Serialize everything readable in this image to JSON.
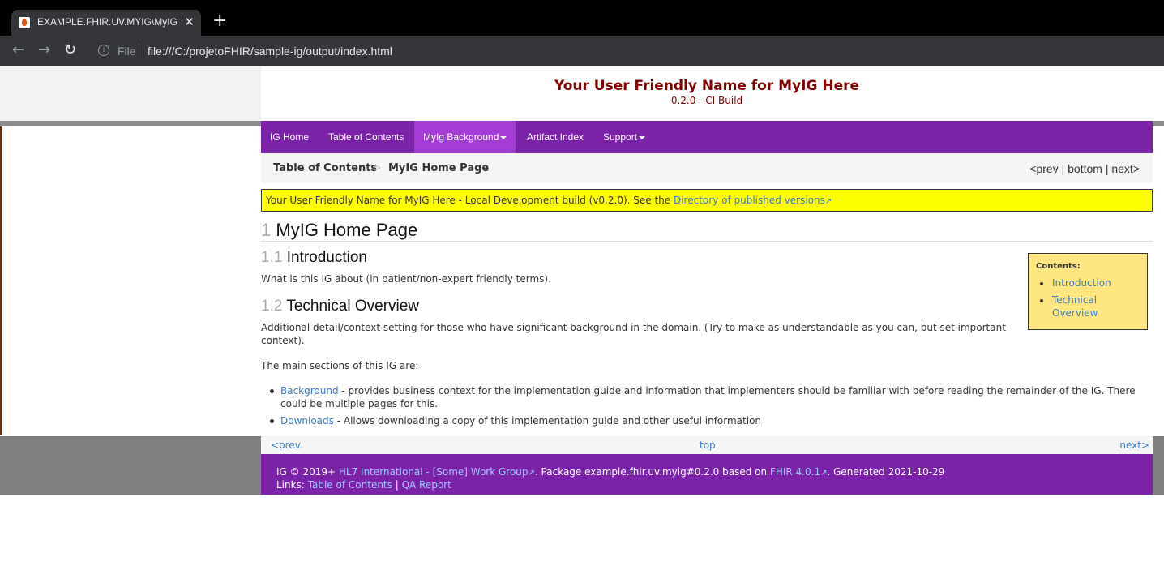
{
  "browser": {
    "tab_title": "EXAMPLE.FHIR.UV.MYIG\\MyIG Home",
    "tab_close": "✕",
    "new_tab": "+",
    "url_scheme_label": "File",
    "url": "file:///C:/projetoFHIR/sample-ig/output/index.html"
  },
  "header": {
    "title": "Your User Friendly Name for MyIG Here",
    "subtitle": "0.2.0 - CI Build"
  },
  "navbar": {
    "items": [
      {
        "label": "IG Home"
      },
      {
        "label": "Table of Contents"
      },
      {
        "label": "MyIg Background"
      },
      {
        "label": "Artifact Index"
      },
      {
        "label": "Support"
      }
    ]
  },
  "breadcrumb": {
    "items": [
      "Table of Contents",
      "MyIG Home Page"
    ],
    "separator": ">",
    "nav": {
      "prev": "<prev",
      "bottom": "bottom",
      "next": "next>",
      "sep": "|"
    }
  },
  "banner": {
    "text": "Your User Friendly Name for MyIG Here - Local Development build (v0.2.0). See the ",
    "link": "Directory of published versions"
  },
  "content": {
    "h1_num": "1",
    "h1": "MyIG Home Page",
    "s1_num": "1.1",
    "s1": "Introduction",
    "s1_text": "What is this IG about (in patient/non-expert friendly terms).",
    "s2_num": "1.2",
    "s2": "Technical Overview",
    "s2_text1": "Additional detail/context setting for those who have significant background in the domain. (Try to make as understandable as you can, but set important",
    "s2_text1b": "context).",
    "s2_text2": "The main sections of this IG are:",
    "list": [
      {
        "link": "Background",
        "text1": " - provides business context for the implementation guide and information that implementers should be familiar with before reading the remainder of the IG. There",
        "text2": "could be multiple pages for this."
      },
      {
        "link": "Downloads",
        "text1": " - Allows downloading a copy of this implementation guide and other useful information"
      }
    ]
  },
  "toc": {
    "heading": "Contents:",
    "items": [
      "Introduction",
      "Technical",
      "Overview"
    ]
  },
  "pager": {
    "prev": "<prev",
    "top": "top",
    "next": "next>"
  },
  "footer": {
    "l1a": "IG © 2019+ ",
    "l1_link1": "HL7 International - [Some] Work Group",
    "l1b": ". Package example.fhir.uv.myig#0.2.0 based on ",
    "l1_link2": "FHIR 4.0.1",
    "l1c": ". Generated 2021-10-29",
    "l2a": "Links: ",
    "l2_link1": "Table of Contents",
    "l2_sep": " | ",
    "l2_link2": "QA Report"
  },
  "colors": {
    "navbar": "#7a23a8",
    "active_nav": "#a23cd5",
    "banner": "#ffff00",
    "title": "#800000",
    "toc_box": "#ffe680"
  }
}
